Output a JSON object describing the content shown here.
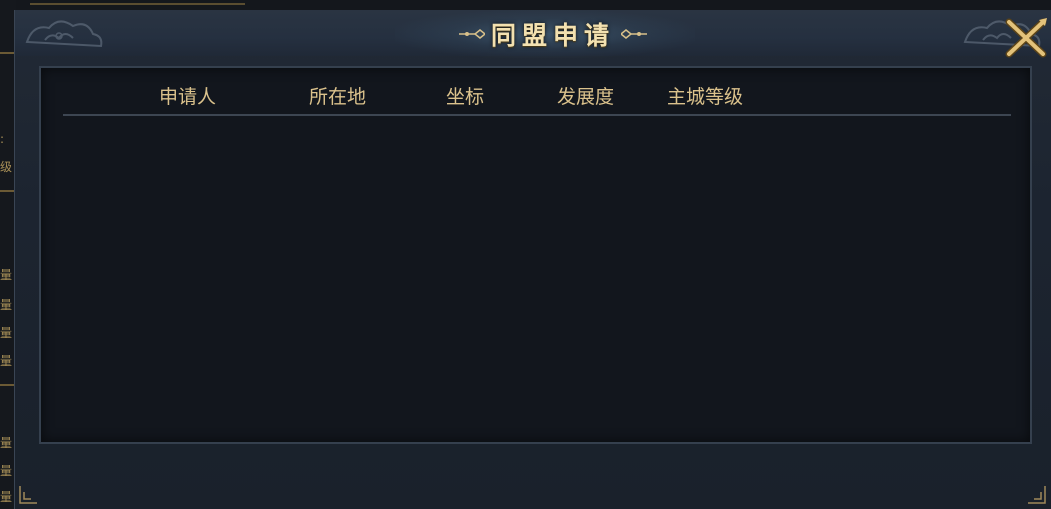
{
  "dialog": {
    "title": "同盟申请",
    "close_icon": "close-x-icon"
  },
  "table": {
    "columns": [
      "申请人",
      "所在地",
      "坐标",
      "发展度",
      "主城等级"
    ],
    "rows": []
  },
  "background": {
    "left_glyphs": [
      ":",
      "级",
      "量",
      "量",
      "量",
      "量",
      "量",
      "量",
      "量"
    ]
  },
  "colors": {
    "title": "#f3e1b0",
    "column_header": "#dbc28c",
    "panel_bg": "#12161d",
    "dialog_bg": "#1c2430",
    "gold_accent": "#c9a55a"
  }
}
